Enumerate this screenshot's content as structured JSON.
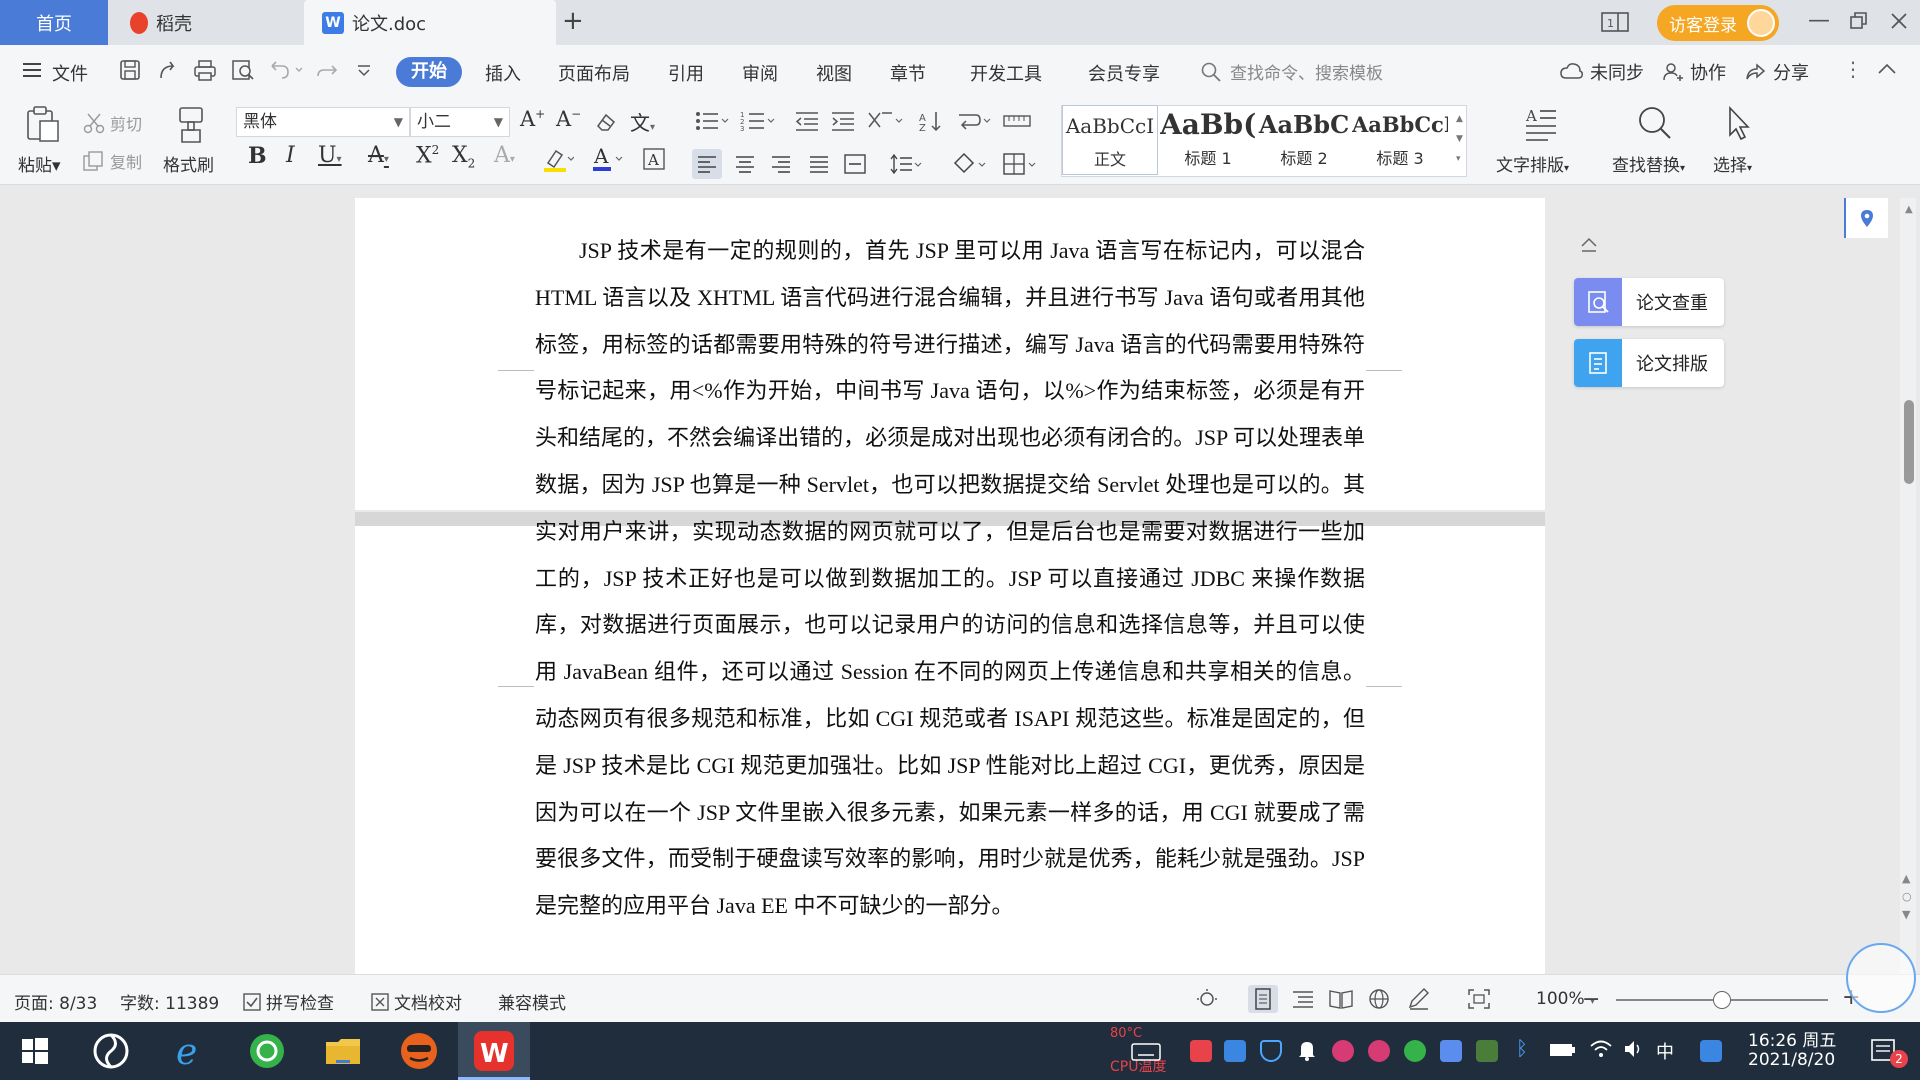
{
  "tabs": {
    "home": "首页",
    "daoke": "稻壳",
    "doc": "论文.doc",
    "new_tab": "+",
    "login": "访客登录"
  },
  "menu": {
    "file": "文件",
    "start": "开始",
    "insert": "插入",
    "layout": "页面布局",
    "reference": "引用",
    "review": "审阅",
    "view": "视图",
    "chapter": "章节",
    "devtools": "开发工具",
    "member": "会员专享",
    "search_placeholder": "查找命令、搜索模板",
    "unsync": "未同步",
    "collab": "协作",
    "share": "分享"
  },
  "ribbon": {
    "paste": "粘贴",
    "cut": "剪切",
    "copy": "复制",
    "format_painter": "格式刷",
    "font_name": "黑体",
    "font_size": "小二",
    "styles": [
      {
        "sample": "AaBbCcI",
        "name": "正文"
      },
      {
        "sample": "AaBb(",
        "name": "标题 1"
      },
      {
        "sample": "AaBbC",
        "name": "标题 2"
      },
      {
        "sample": "AaBbCcI",
        "name": "标题 3"
      }
    ],
    "text_layout": "文字排版",
    "find_replace": "查找替换",
    "select": "选择"
  },
  "document": {
    "paragraph": "JSP 技术是有一定的规则的，首先 JSP 里可以用 Java 语言写在标记内，可以混合 HTML 语言以及 XHTML 语言代码进行混合编辑，并且进行书写 Java 语句或者用其他标签，用标签的话都需要用特殊的符号进行描述，编写 Java 语言的代码需要用特殊符号标记起来，用<%作为开始，中间书写 Java 语句，以%>作为结束标签，必须是有开头和结尾的，不然会编译出错的，必须是成对出现也必须有闭合的。JSP 可以处理表单数据，因为 JSP 也算是一种 Servlet，也可以把数据提交给 Servlet 处理也是可以的。其实对用户来讲，实现动态数据的网页就可以了，但是后台也是需要对数据进行一些加工的，JSP 技术正好也是可以做到数据加工的。JSP 可以直接通过 JDBC 来操作数据库，对数据进行页面展示，也可以记录用户的访问的信息和选择信息等，并且可以使用 JavaBean 组件，还可以通过 Session 在不同的网页上传递信息和共享相关的信息。动态网页有很多规范和标准，比如 CGI 规范或者 ISAPI 规范这些。标准是固定的，但是 JSP 技术是比 CGI 规范更加强壮。比如 JSP 性能对比上超过 CGI，更优秀，原因是因为可以在一个 JSP 文件里嵌入很多元素，如果元素一样多的话，用 CGI 就要成了需要很多文件，而受制于硬盘读写效率的影响，用时少就是优秀，能耗少就是强劲。JSP 是完整的应用平台 Java EE 中不可缺少的一部分。"
  },
  "side_panel": {
    "check": "论文查重",
    "format": "论文排版"
  },
  "status": {
    "page": "页面: 8/33",
    "words": "字数: 11389",
    "spell": "拼写检查",
    "proof": "文档校对",
    "compat": "兼容模式",
    "zoom": "100%",
    "zoom_level": 0.5
  },
  "taskbar": {
    "time": "16:26 周五",
    "date": "2021/8/20",
    "ime": "中",
    "cpu_temp": "CPU温度",
    "cpu_value": "80°C",
    "notif_count": "2"
  },
  "colors": {
    "accent": "#4a7bd6",
    "login": "#f5a623",
    "taskbar": "#1f2d3d"
  }
}
